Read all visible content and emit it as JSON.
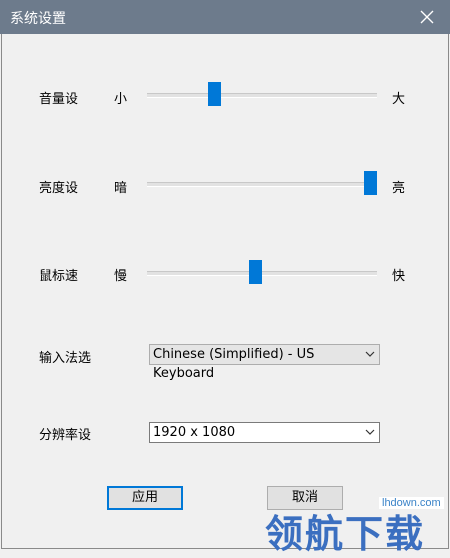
{
  "window": {
    "title": "系统设置"
  },
  "volume": {
    "label": "音量设",
    "min_label": "小",
    "max_label": "大",
    "value": 0.29
  },
  "brightness": {
    "label": "亮度设",
    "min_label": "暗",
    "max_label": "亮",
    "value": 0.97
  },
  "mouse": {
    "label": "鼠标速",
    "min_label": "慢",
    "max_label": "快",
    "value": 0.47
  },
  "input_method": {
    "label": "输入法选",
    "selected": "Chinese (Simplified) - US Keyboard"
  },
  "resolution": {
    "label": "分辨率设",
    "selected": "1920 x 1080"
  },
  "buttons": {
    "apply": "应用",
    "cancel": "取消"
  },
  "watermark": {
    "url": "lhdown.com",
    "text": "领航下载"
  },
  "colors": {
    "titlebar": "#6d7b8c",
    "accent": "#0078d7",
    "watermark": "#3b6fc0"
  }
}
